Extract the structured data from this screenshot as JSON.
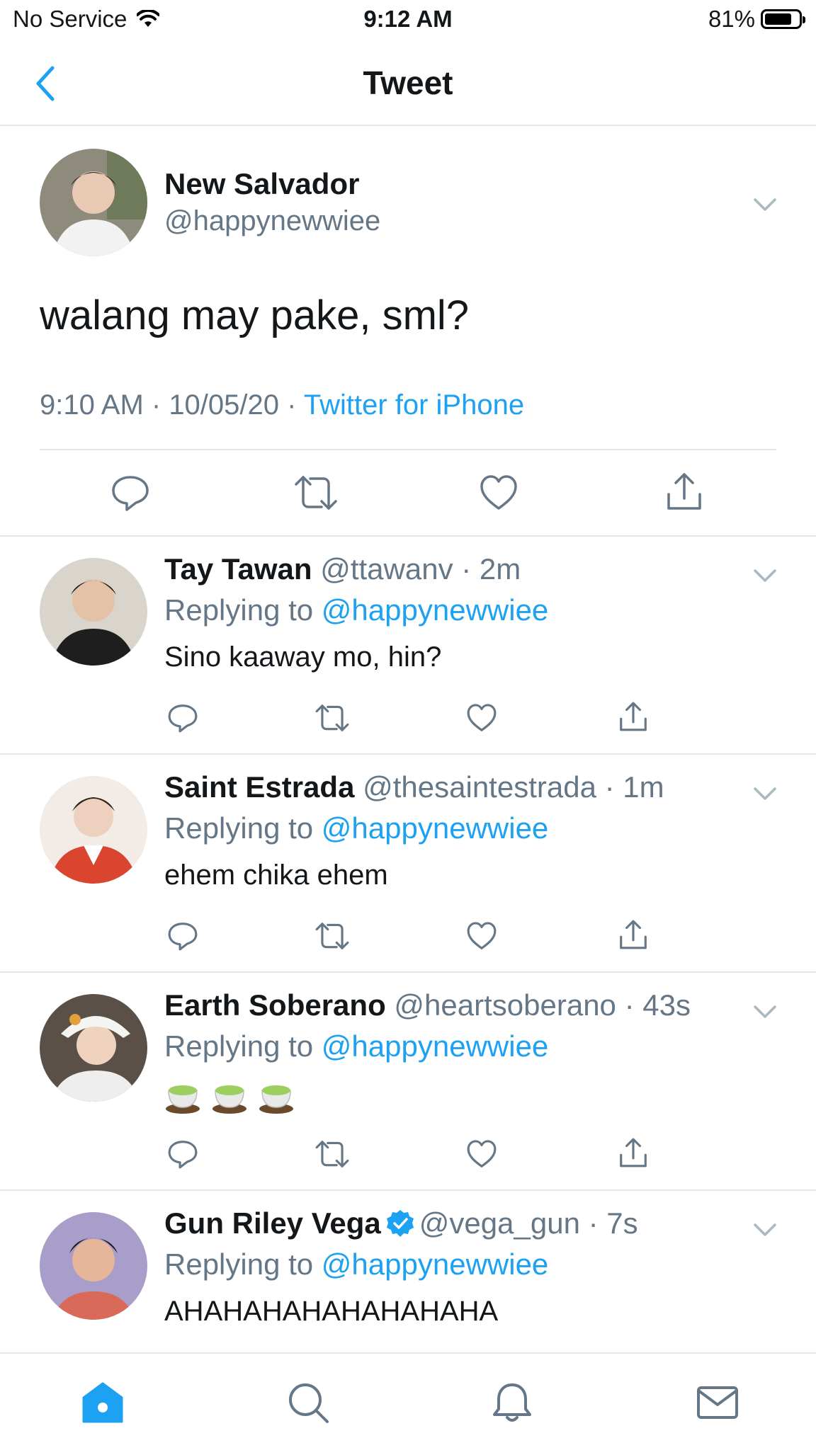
{
  "status_bar": {
    "carrier": "No Service",
    "time": "9:12 AM",
    "battery_percent": "81%",
    "battery_level": 0.81
  },
  "nav": {
    "title": "Tweet",
    "back_icon": "chevron-left-icon"
  },
  "main_tweet": {
    "name": "New Salvador",
    "handle": "@happynewwiee",
    "text": "walang may pake, sml?",
    "time": "9:10 AM",
    "date": "10/05/20",
    "separator": " · ",
    "source": "Twitter for iPhone"
  },
  "replies": [
    {
      "name": "Tay Tawan",
      "handle": "@ttawanv",
      "time": "2m",
      "replying_label": "Replying to",
      "replying_to": "@happynewwiee",
      "text": "Sino kaaway mo, hin?",
      "verified": false
    },
    {
      "name": "Saint Estrada",
      "handle": "@thesaintestrada",
      "time": "1m",
      "replying_label": "Replying to",
      "replying_to": "@happynewwiee",
      "text": "ehem chika ehem",
      "verified": false
    },
    {
      "name": "Earth Soberano",
      "handle": "@heartsoberano",
      "time": "43s",
      "replying_label": "Replying to",
      "replying_to": "@happynewwiee",
      "text": "",
      "emoji_icons": [
        "tea-cup-icon",
        "tea-cup-icon",
        "tea-cup-icon"
      ],
      "verified": false
    },
    {
      "name": "Gun Riley Vega",
      "handle": "@vega_gun",
      "time": "7s",
      "replying_label": "Replying to",
      "replying_to": "@happynewwiee",
      "text": "AHAHAHAHAHAHAHAHA",
      "verified": true
    }
  ],
  "tab_bar": {
    "items": [
      "home-icon",
      "search-icon",
      "bell-icon",
      "mail-icon"
    ],
    "active": "home-icon"
  },
  "colors": {
    "accent": "#1da1f2",
    "muted": "#657786",
    "text": "#14171a",
    "divider": "#e1e8ed"
  }
}
